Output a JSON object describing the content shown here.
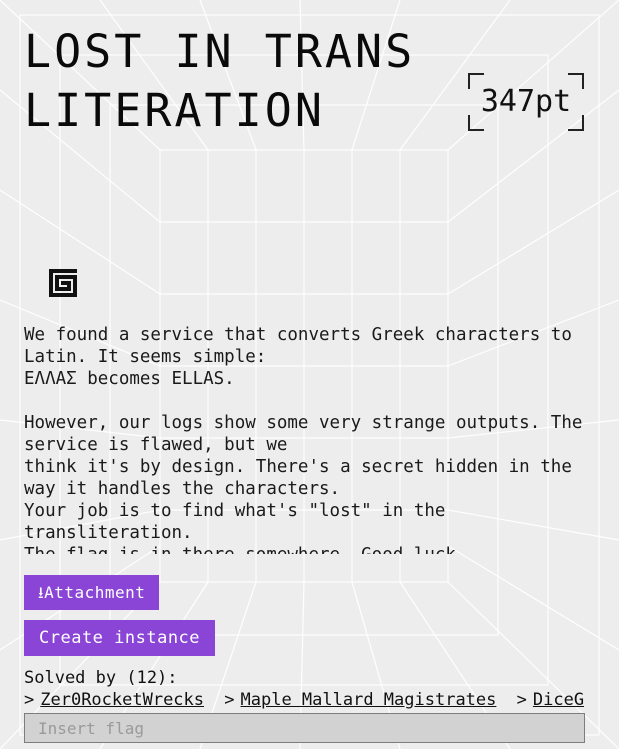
{
  "challenge": {
    "title": "LOST IN TRANSLITERATION",
    "points": "347pt",
    "category_icon": "spiral-icon"
  },
  "description": {
    "lines": [
      "We found a service that converts Greek characters to Latin. It seems simple:",
      "ΕΛΛΑΣ becomes ELLAS.",
      "",
      "However, our logs show some very strange outputs. The service is flawed, but we",
      "think it's by design. There's a secret hidden in the way it handles the characters.",
      "Your job is to find what's \"lost\" in the transliteration.",
      "The flag is in there somewhere. Good luck."
    ]
  },
  "actions": {
    "attachment_label": "⭳Attachment",
    "create_instance_label": "Create instance"
  },
  "solves": {
    "title": "Solved by (12):",
    "teams": [
      "Zer0RocketWrecks",
      "Maple Mallard Magistrates",
      "DiceGang"
    ]
  },
  "flag_input": {
    "placeholder": "Insert flag",
    "value": ""
  },
  "colors": {
    "accent": "#8a44d6",
    "background": "#ededed",
    "text": "#111111"
  }
}
